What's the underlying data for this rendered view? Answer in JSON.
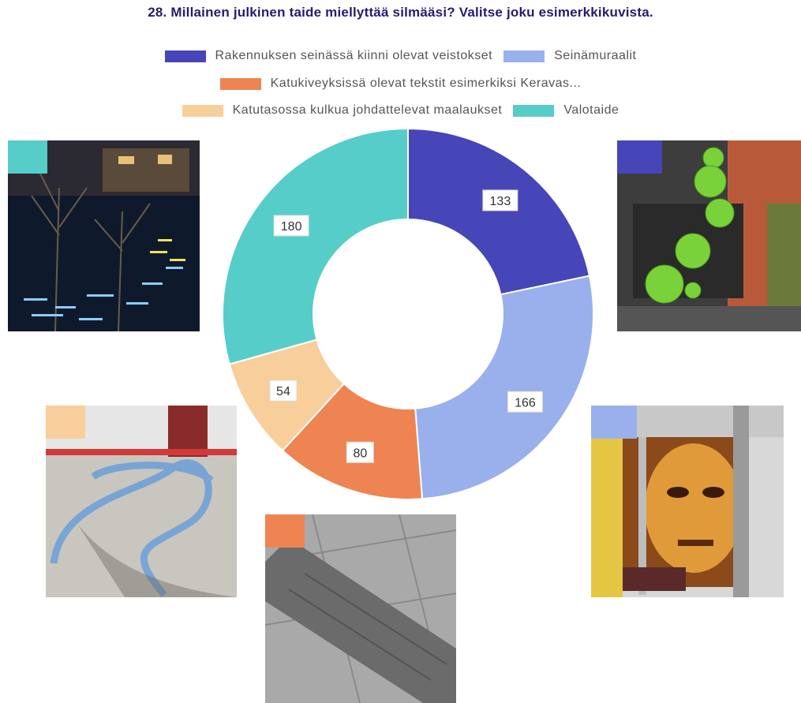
{
  "chart_data": {
    "type": "pie",
    "title": "28. Millainen julkinen taide miellyttää silmääsi? Valitse joku esimerkkikuvista.",
    "donut": true,
    "legend_position": "top",
    "categories": [
      "Rakennuksen seinässä kiinni olevat veistokset",
      "Seinämuraalit",
      "Katukiveyksissä olevat tekstit esimerkiksi Keravas...",
      "Katutasossa kulkua johdattelevat maalaukset",
      "Valotaide"
    ],
    "values": [
      133,
      166,
      80,
      54,
      180
    ],
    "colors": [
      "#4646b9",
      "#9ab0ec",
      "#ee8452",
      "#f8cf9a",
      "#56cdc9"
    ]
  },
  "photos": [
    {
      "name": "valotaide-photo",
      "depicts": "light art on plaza at night",
      "color": "#56cdc9"
    },
    {
      "name": "veistokset-photo",
      "depicts": "green spheres sculpture on brick wall",
      "color": "#4646b9"
    },
    {
      "name": "maalaukset-photo",
      "depicts": "blue painted lines on pavement",
      "color": "#f8cf9a"
    },
    {
      "name": "muraalit-photo",
      "depicts": "face mural on building",
      "color": "#9ab0ec"
    },
    {
      "name": "tekstit-photo",
      "depicts": "engraved text in paving stone",
      "color": "#ee8452"
    }
  ]
}
